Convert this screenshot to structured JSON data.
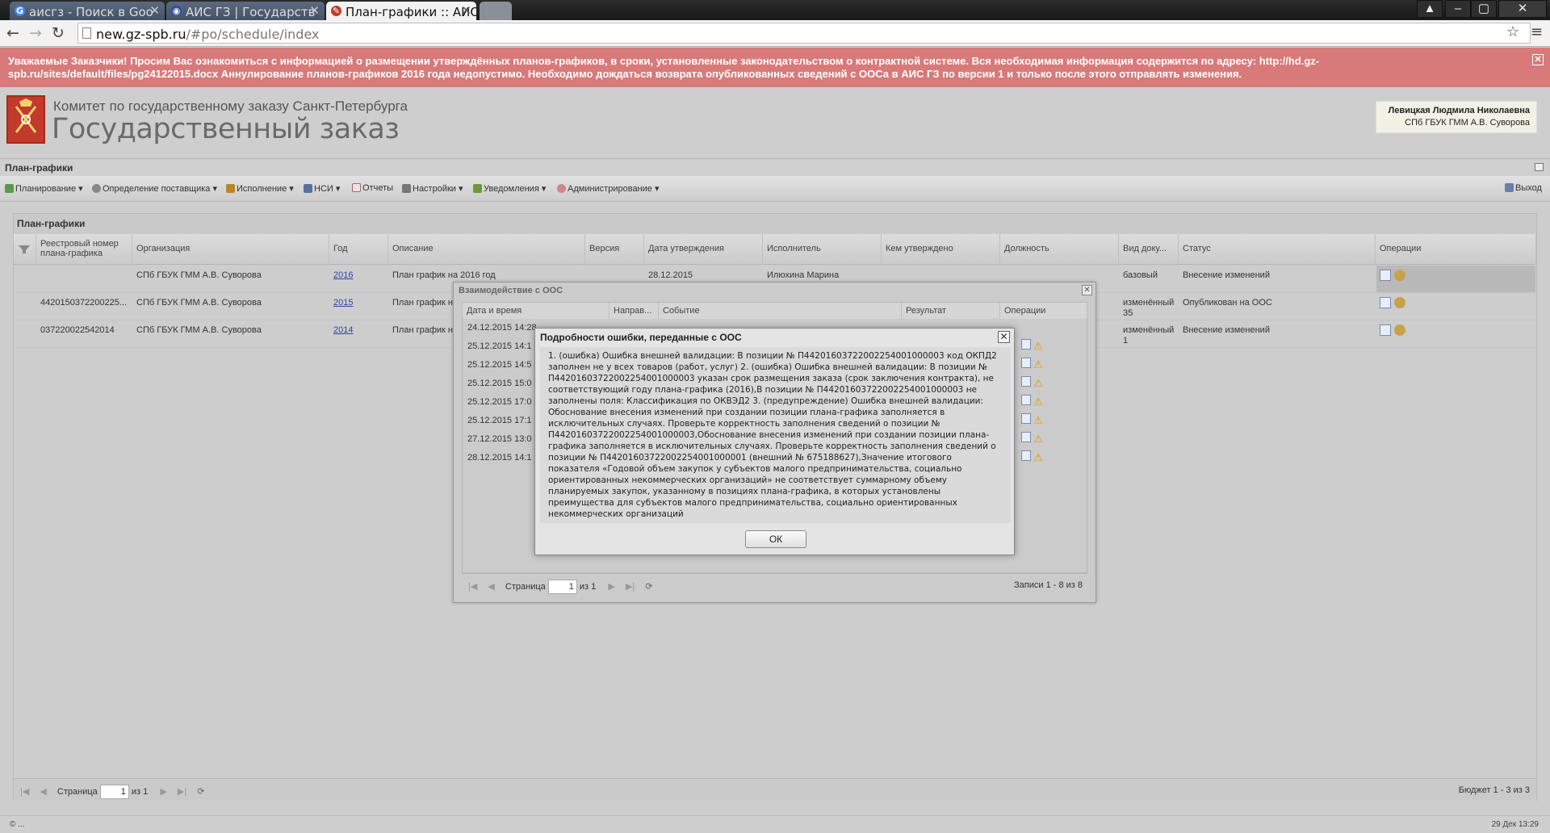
{
  "browser": {
    "tabs": [
      {
        "title": "аисгз - Поиск в Goo",
        "favicon": "G"
      },
      {
        "title": "АИС ГЗ | Государств",
        "favicon": "◉"
      },
      {
        "title": "План-графики :: АИС",
        "favicon": "✎"
      }
    ],
    "url_host": "new.gz-spb.ru",
    "url_path": "/#po/schedule/index"
  },
  "banner": {
    "text": "Уважаемые Заказчики! Просим Вас ознакомиться с информацией о размещении утверждённых планов-графиков, в сроки, установленные законодательством о контрактной системе. Вся необходимая информация содержится по адресу: http://hd.gz-spb.ru/sites/default/files/pg24122015.docx Аннулирование планов-графиков 2016 года недопустимо. Необходимо дождаться возврата опубликованных сведений с ООСа в АИС ГЗ по версии 1 и только после этого отправлять изменения."
  },
  "header": {
    "org_line": "Комитет по государственному заказу Санкт-Петербурга",
    "system_title": "Государственный заказ",
    "user_name": "Левицкая Людмила Николаевна",
    "user_org": "СПб ГБУК ГММ А.В. Суворова"
  },
  "app": {
    "section_title": "План-графики",
    "menu": [
      "Планирование",
      "Определение поставщика",
      "Исполнение",
      "НСИ",
      "Отчеты",
      "Настройки",
      "Уведомления",
      "Администрирование"
    ],
    "exit_label": "Выход"
  },
  "grid": {
    "title": "План-графики",
    "columns": [
      "Реестровый номер плана-графика",
      "Организация",
      "Год",
      "Описание",
      "Версия",
      "Дата утверждения",
      "Исполнитель",
      "Кем утверждено",
      "Должность",
      "Вид доку...",
      "Статус",
      "Операции"
    ],
    "rows": [
      {
        "reg": "",
        "org": "СПб ГБУК ГММ А.В. Суворова",
        "year": "2016",
        "desc": "План график на 2016 год",
        "version": "",
        "date": "28.12.2015",
        "executor": "Илюхина Марина",
        "approved_by": "",
        "position": "",
        "doc_type": "базовый",
        "doc_type2": "",
        "status": "Внесение изменений"
      },
      {
        "reg": "4420150372200225...",
        "org": "СПб ГБУК ГММ А.В. Суворова",
        "year": "2015",
        "desc": "План график н",
        "version": "",
        "date": "",
        "executor": "",
        "approved_by": "",
        "position": "",
        "doc_type": "изменённый",
        "doc_type2": "35",
        "status": "Опубликован на ООС"
      },
      {
        "reg": "037220022542014",
        "org": "СПб ГБУК ГММ А.В. Суворова",
        "year": "2014",
        "desc": "План график н",
        "version": "",
        "date": "",
        "executor": "",
        "approved_by": "",
        "position": "",
        "doc_type": "изменённый",
        "doc_type2": "1",
        "status": "Внесение изменений"
      }
    ],
    "pager": {
      "page_label": "Страница",
      "page": "1",
      "of": "из 1",
      "summary": "Бюджет 1 - 3 из 3"
    }
  },
  "dialog_oos": {
    "title": "Взаимодействие с ООС",
    "columns": [
      "Дата и время",
      "Направ...",
      "Событие",
      "Результат",
      "Операции"
    ],
    "rows": [
      "24.12.2015 14:28",
      "25.12.2015 14:1",
      "25.12.2015 14:5",
      "25.12.2015 15:0",
      "25.12.2015 17:0",
      "25.12.2015 17:1",
      "27.12.2015 13:0",
      "28.12.2015 14:1"
    ],
    "pager": {
      "page_label": "Страница",
      "page": "1",
      "of": "из 1",
      "summary": "Записи 1 - 8 из 8"
    }
  },
  "dialog_error": {
    "title": "Подробности ошибки, переданные с ООС",
    "text": "1. (ошибка) Ошибка внешней валидации: В позиции № П44201603722002254001000003 код ОКПД2 заполнен не у всех товаров (работ, услуг) 2. (ошибка) Ошибка внешней валидации: В позиции № П44201603722002254001000003 указан срок размещения заказа (срок заключения контракта), не соответствующий году плана-графика (2016),В позиции № П44201603722002254001000003 не заполнены поля: Классификация по ОКВЭД2 3. (предупреждение) Ошибка внешней валидации: Обоснование внесения изменений при создании позиции плана-графика заполняется в исключительных случаях. Проверьте корректность заполнения сведений о позиции № П44201603722002254001000003,Обоснование внесения изменений при создании позиции плана-графика заполняется в исключительных случаях. Проверьте корректность заполнения сведений о позиции № П44201603722002254001000001 (внешний № 675188627),Значение итогового показателя «Годовой объем закупок у субъектов малого предпринимательства, социально ориентированных некоммерческих организаций» не соответствует суммарному объему планируемых закупок, указанному в позициях плана-графика, в которых установлены преимущества для субъектов малого предпринимательства, социально ориентированных некоммерческих организаций",
    "ok_label": "ОК"
  },
  "statusbar": {
    "left": "© ...",
    "right": "29 Дек 13:29"
  },
  "colors": {
    "banner": "#d87a7a",
    "link": "#3044a8",
    "logo": "#c13a2a"
  }
}
